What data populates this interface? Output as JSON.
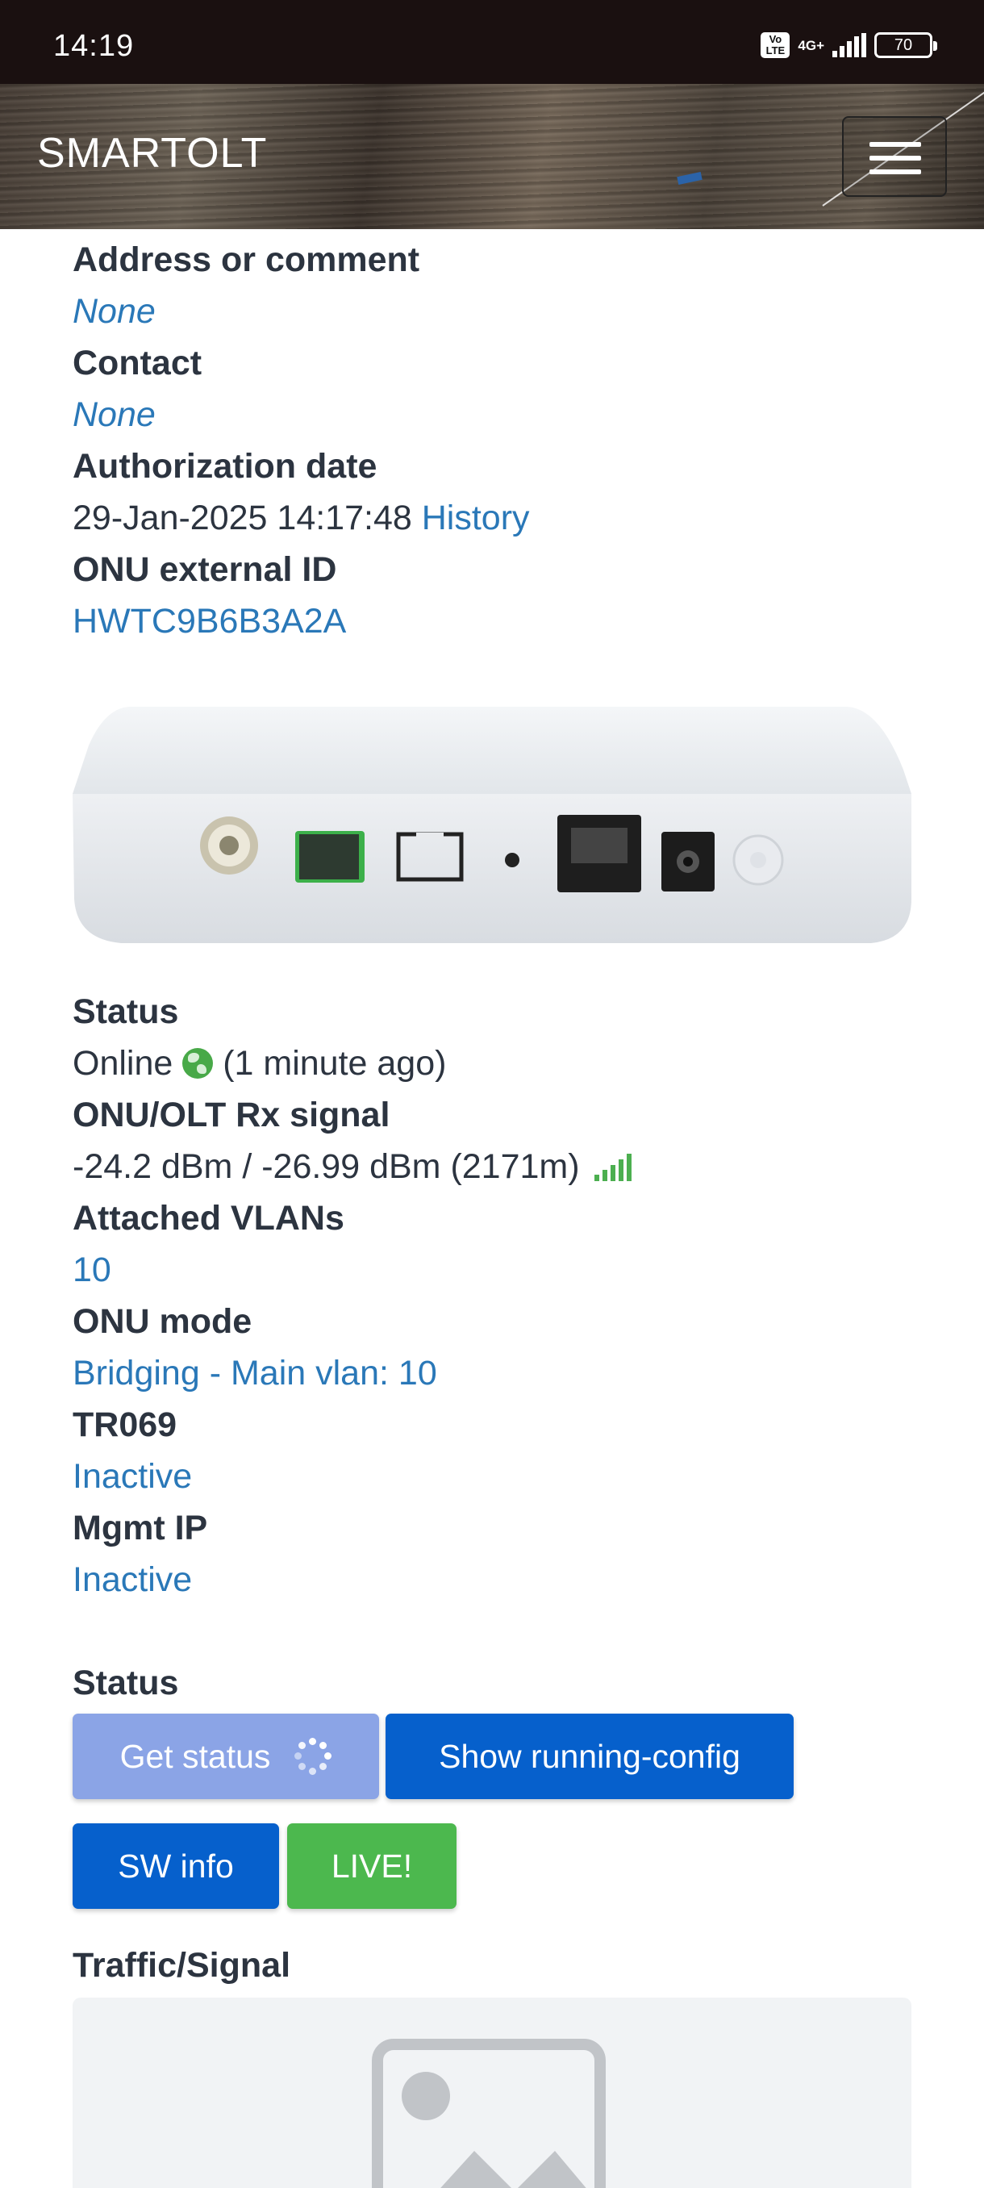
{
  "status_bar": {
    "time": "14:19",
    "volte": "Vo LTE",
    "network": "4G+",
    "battery": "70"
  },
  "navbar": {
    "brand": "SMARTOLT",
    "menu_icon": "hamburger-menu-icon"
  },
  "details": {
    "address_label": "Address or comment",
    "address_value": "None",
    "contact_label": "Contact",
    "contact_value": "None",
    "auth_label": "Authorization date",
    "auth_date": "29-Jan-2025 14:17:48",
    "history_link": "History",
    "external_id_label": "ONU external ID",
    "external_id_value": "HWTC9B6B3A2A"
  },
  "device_image": "onu-device-image",
  "status_info": {
    "status_label": "Status",
    "status_value": "Online",
    "status_icon": "globe-icon",
    "status_time": "(1 minute ago)",
    "signal_label": "ONU/OLT Rx signal",
    "signal_value": "-24.2 dBm / -26.99 dBm (2171m)",
    "signal_icon": "signal-strength-icon",
    "vlans_label": "Attached VLANs",
    "vlans_value": "10",
    "mode_label": "ONU mode",
    "mode_value": "Bridging - Main vlan: 10",
    "tr069_label": "TR069",
    "tr069_value": "Inactive",
    "mgmt_label": "Mgmt IP",
    "mgmt_value": "Inactive"
  },
  "actions": {
    "section_label": "Status",
    "get_status": "Get status",
    "show_config": "Show running-config",
    "sw_info": "SW info",
    "live": "LIVE!"
  },
  "traffic": {
    "label": "Traffic/Signal",
    "image_icon": "image-placeholder-icon"
  },
  "colors": {
    "link": "#2a78b8",
    "primary": "#0660cc",
    "primary_disabled": "#8ba4e6",
    "success": "#4cb84e"
  }
}
